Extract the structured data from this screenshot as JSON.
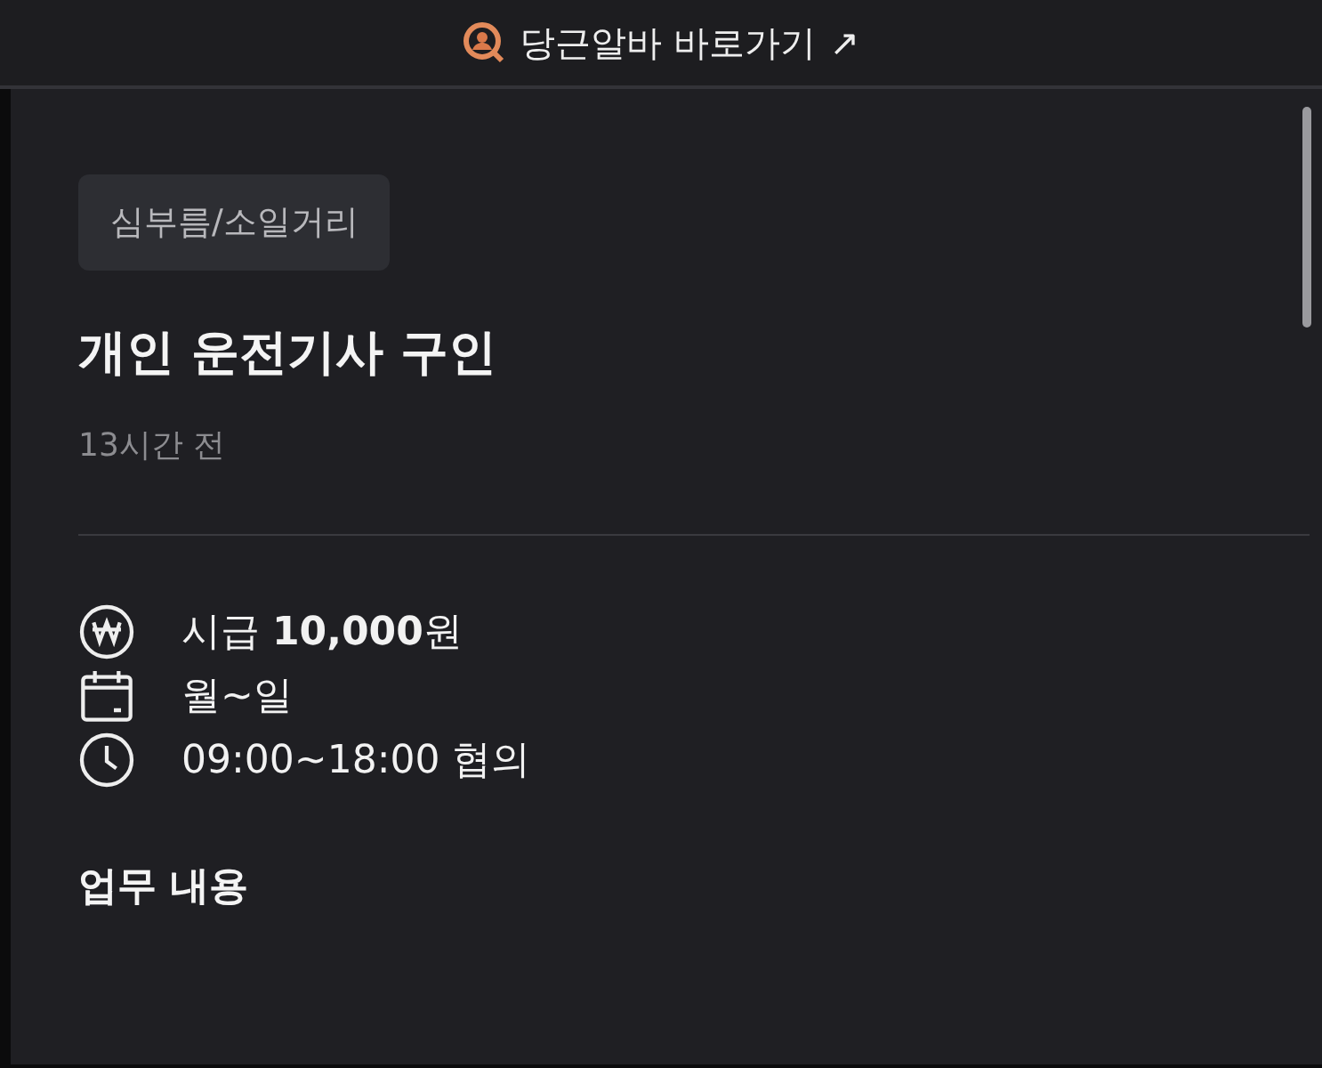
{
  "top_bar": {
    "link": "당근알바 바로가기",
    "arrow": "↗"
  },
  "post": {
    "category": "심부름/소일거리",
    "title": "개인 운전기사 구인",
    "posted": "13시간 전",
    "details": [
      {
        "kind": "pay",
        "text": "시급 **10,000**원"
      },
      {
        "kind": "days",
        "text": "월~일"
      },
      {
        "kind": "hours",
        "text": "09:00~18:00 협의"
      }
    ],
    "section_heading": "업무 내용"
  }
}
